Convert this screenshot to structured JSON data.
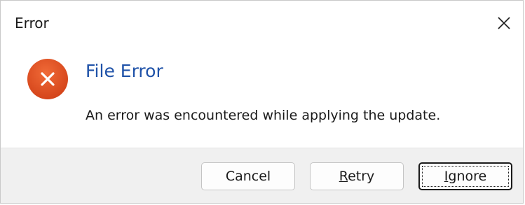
{
  "window": {
    "title": "Error",
    "close_icon": "close-icon"
  },
  "content": {
    "icon": "error-x-icon",
    "icon_color": "#e3521d",
    "main_instruction": "File Error",
    "message": "An error was encountered while applying the update.",
    "instruction_color": "#1f52a8"
  },
  "buttons": {
    "cancel_label": "Cancel",
    "retry_label_accel": "R",
    "retry_label_rest": "etry",
    "ignore_label_accel": "I",
    "ignore_label_rest": "gnore",
    "focused": "ignore"
  }
}
